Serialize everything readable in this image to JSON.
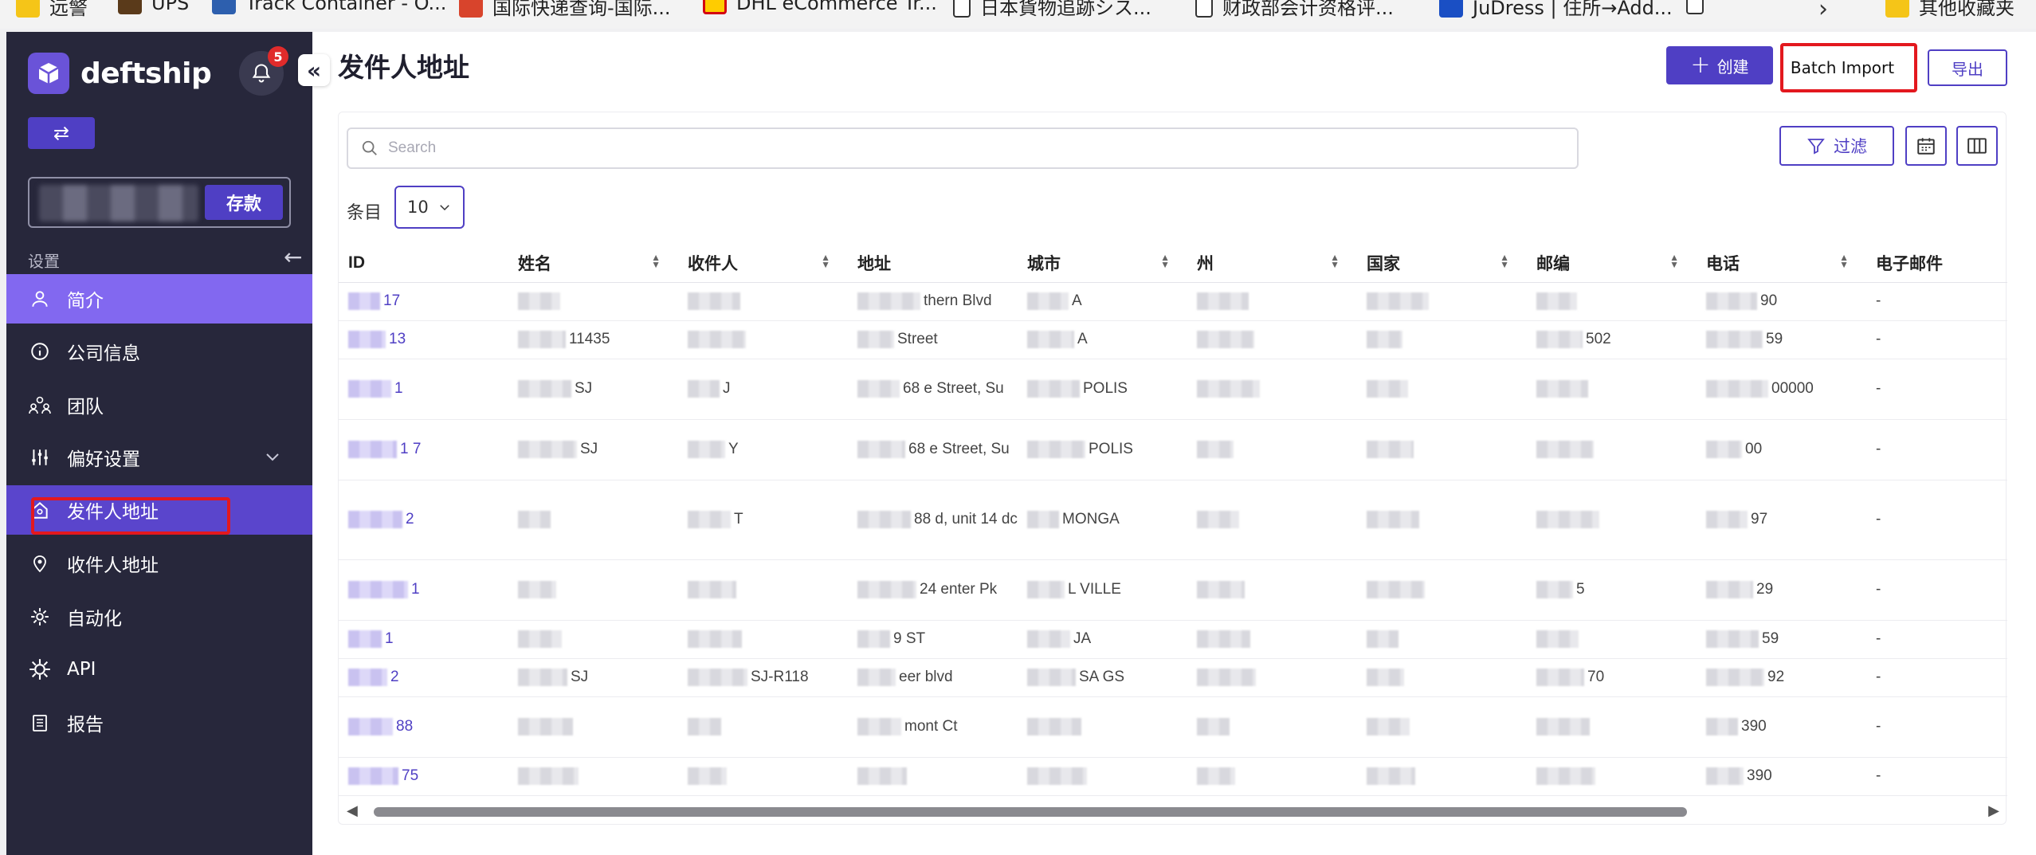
{
  "bookmarks": [
    {
      "label": "远警",
      "icon": "folder-icon"
    },
    {
      "label": "UPS",
      "icon": "ups-icon"
    },
    {
      "label": "Track Container - O...",
      "icon": "anchor-icon"
    },
    {
      "label": "国际快递查询-国际...",
      "icon": "bird-icon"
    },
    {
      "label": "DHL eCommerce Tr...",
      "icon": "dhl-icon"
    },
    {
      "label": "日本貨物追跡シス...",
      "icon": "document-icon"
    },
    {
      "label": "财政部会计资格评...",
      "icon": "document-icon"
    },
    {
      "label": "JuDress | 住所→Add...",
      "icon": "facebook-icon"
    },
    {
      "label": "",
      "icon": "document-icon"
    },
    {
      "label": "其他收藏夹",
      "icon": "folder-icon"
    }
  ],
  "sidebar": {
    "logo_text": "deftship",
    "notification_count": "5",
    "deposit_label": "存款",
    "section_label": "设置",
    "items": [
      {
        "label": "简介",
        "icon": "user-icon"
      },
      {
        "label": "公司信息",
        "icon": "info-icon"
      },
      {
        "label": "团队",
        "icon": "team-icon"
      },
      {
        "label": "偏好设置",
        "icon": "sliders-icon"
      },
      {
        "label": "发件人地址",
        "icon": "sender-house-icon"
      },
      {
        "label": "收件人地址",
        "icon": "location-pin-icon"
      },
      {
        "label": "自动化",
        "icon": "automation-gear-icon"
      },
      {
        "label": "API",
        "icon": "api-gear-icon"
      },
      {
        "label": "报告",
        "icon": "report-clipboard-icon"
      }
    ]
  },
  "main": {
    "title": "发件人地址",
    "create_label": "创建",
    "batch_import_label": "Batch Import",
    "export_label": "导出",
    "search_placeholder": "Search",
    "filter_label": "过滤",
    "rows_label": "条目",
    "rows_value": "10"
  },
  "table": {
    "columns": [
      "ID",
      "姓名",
      "收件人",
      "地址",
      "城市",
      "州",
      "国家",
      "邮编",
      "电话",
      "电子邮件"
    ],
    "rows": [
      {
        "id": "17",
        "name": "",
        "recipient": "",
        "address": "thern Blvd",
        "city": "A",
        "state": "",
        "country": "",
        "zip": "",
        "phone": "90",
        "email": "-"
      },
      {
        "id": "13",
        "name": "11435",
        "recipient": "",
        "address": "Street",
        "city": "A",
        "state": "",
        "country": "",
        "zip": "502",
        "phone": "59",
        "email": "-"
      },
      {
        "id": "1",
        "name": "SJ",
        "recipient": "J",
        "address": "68 e Street, Su",
        "city": "POLIS",
        "state": "",
        "country": "",
        "zip": "",
        "phone": "00000",
        "email": "-"
      },
      {
        "id": "1 7",
        "name": "SJ",
        "recipient": "Y",
        "address": "68 e Street, Su",
        "city": "POLIS",
        "state": "",
        "country": "",
        "zip": "",
        "phone": "00",
        "email": "-"
      },
      {
        "id": "2",
        "name": "",
        "recipient": "T",
        "address": "88 d, unit 14 dc",
        "city": "MONGA",
        "state": "",
        "country": "",
        "zip": "",
        "phone": "97",
        "email": "-"
      },
      {
        "id": "1",
        "name": "",
        "recipient": "",
        "address": "24 enter Pk",
        "city": "L VILLE",
        "state": "",
        "country": "",
        "zip": "5",
        "phone": "29",
        "email": "-"
      },
      {
        "id": "1",
        "name": "",
        "recipient": "",
        "address": "9 ST",
        "city": "JA",
        "state": "",
        "country": "",
        "zip": "",
        "phone": "59",
        "email": "-"
      },
      {
        "id": "2",
        "name": "SJ",
        "recipient": "SJ-R118",
        "address": "eer blvd",
        "city": "SA GS",
        "state": "",
        "country": "",
        "zip": "70",
        "phone": "92",
        "email": "-"
      },
      {
        "id": "88",
        "name": "",
        "recipient": "",
        "address": "mont Ct",
        "city": "",
        "state": "",
        "country": "",
        "zip": "",
        "phone": "390",
        "email": "-"
      },
      {
        "id": "75",
        "name": "",
        "recipient": "",
        "address": "",
        "city": "",
        "state": "",
        "country": "",
        "zip": "",
        "phone": "390",
        "email": "-"
      }
    ]
  },
  "colors": {
    "brand": "#4f3fc4",
    "sidebar_bg": "#27273b",
    "active_item": "#8268f0",
    "highlight_red": "#e3181e"
  }
}
